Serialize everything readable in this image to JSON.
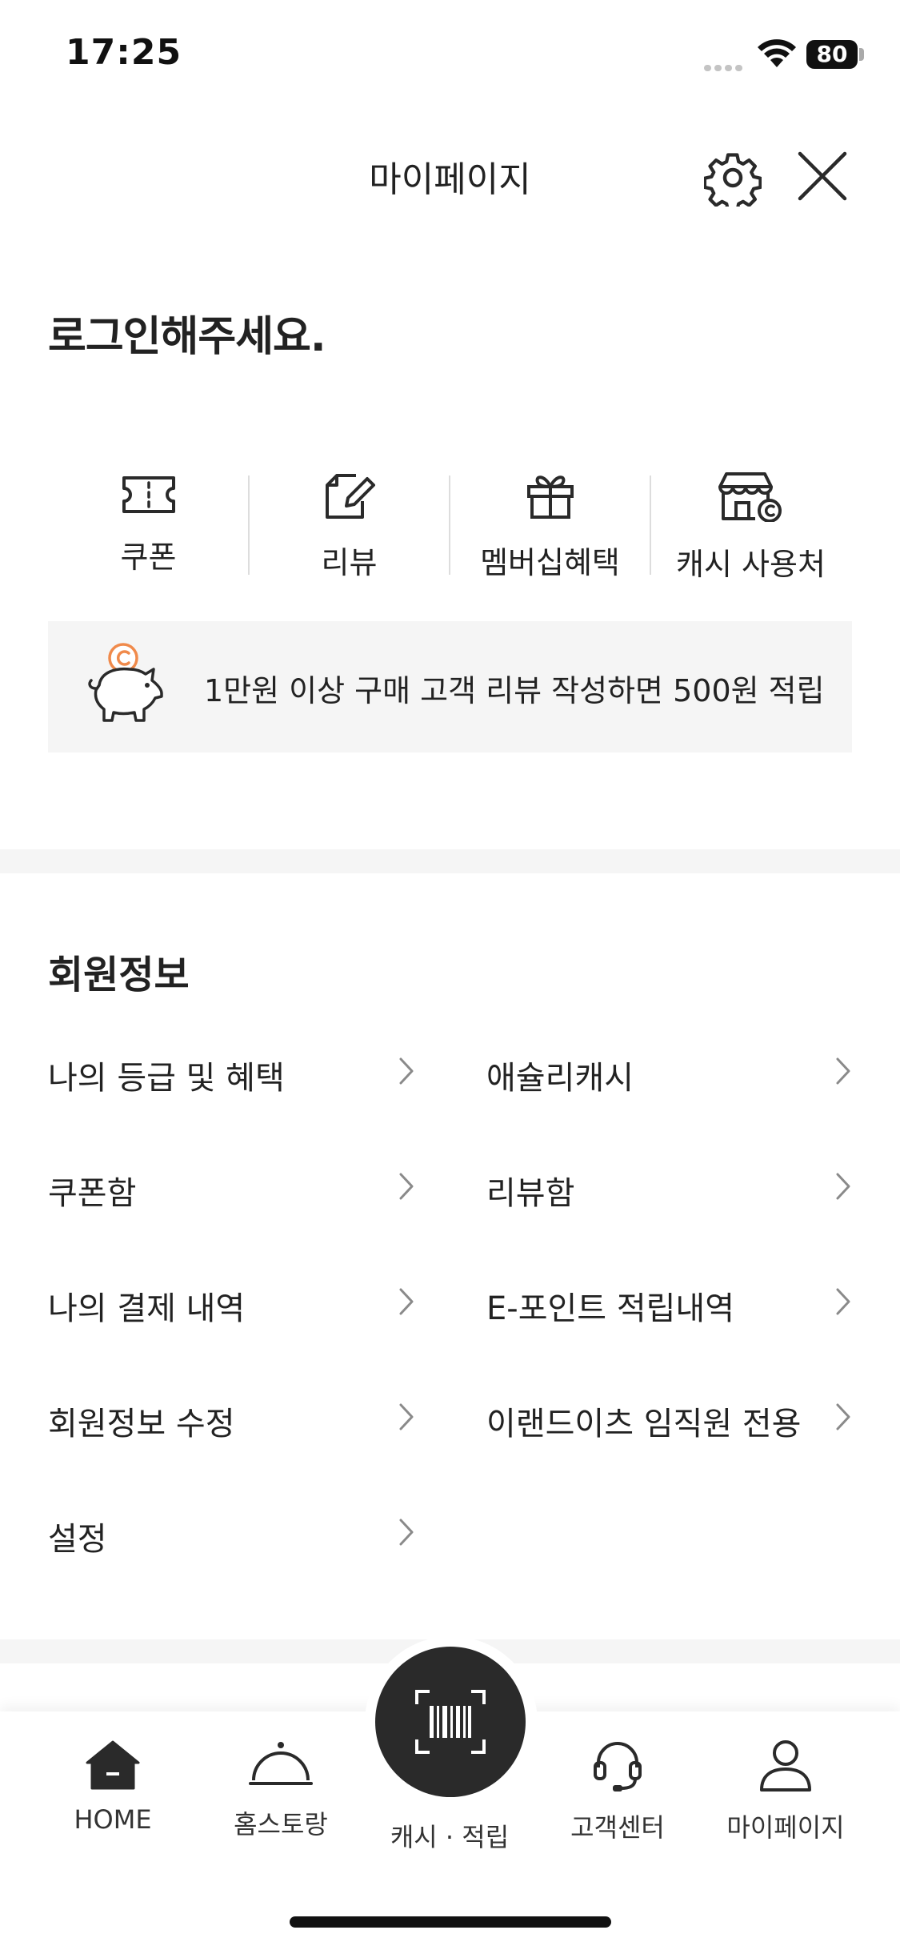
{
  "status_bar": {
    "time": "17:25",
    "battery": "80"
  },
  "header": {
    "title": "마이페이지"
  },
  "login_prompt": "로그인해주세요.",
  "quick_menu": [
    {
      "label": "쿠폰",
      "icon": "ticket-icon"
    },
    {
      "label": "리뷰",
      "icon": "edit-document-icon"
    },
    {
      "label": "멤버십혜택",
      "icon": "gift-icon"
    },
    {
      "label": "캐시 사용처",
      "icon": "store-cash-icon"
    }
  ],
  "banner": {
    "text": "1만원 이상 구매 고객 리뷰 작성하면 500원 적립",
    "icon": "piggy-bank-coin-icon"
  },
  "member_section": {
    "title": "회원정보",
    "items": [
      {
        "label": "나의 등급 및 혜택"
      },
      {
        "label": "애슐리캐시"
      },
      {
        "label": "쿠폰함"
      },
      {
        "label": "리뷰함"
      },
      {
        "label": "나의 결제 내역"
      },
      {
        "label": "E-포인트 적립내역"
      },
      {
        "label": "회원정보 수정"
      },
      {
        "label": "이랜드이츠 임직원 전용"
      },
      {
        "label": "설정"
      }
    ]
  },
  "bottom_nav": {
    "items": [
      {
        "label": "HOME",
        "icon": "home-icon"
      },
      {
        "label": "홈스토랑",
        "icon": "cloche-icon"
      },
      {
        "label": "캐시 · 적립",
        "icon": "barcode-scan-icon"
      },
      {
        "label": "고객센터",
        "icon": "headset-icon"
      },
      {
        "label": "마이페이지",
        "icon": "person-icon"
      }
    ]
  }
}
